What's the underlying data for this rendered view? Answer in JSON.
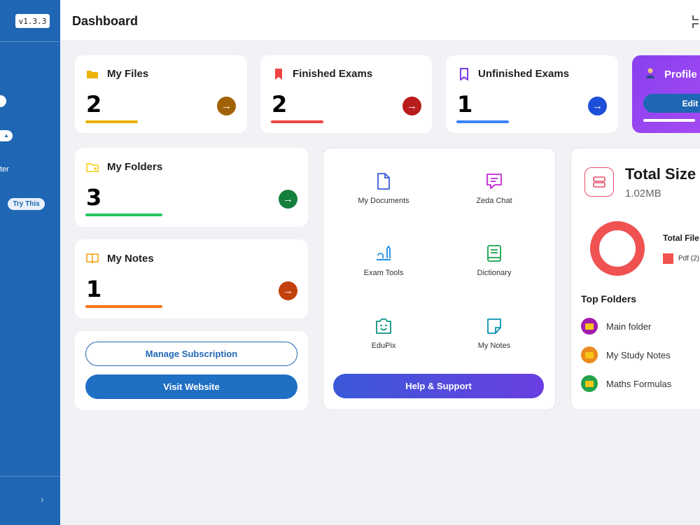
{
  "app": {
    "version": "v1.3.3",
    "page_title": "Dashboard"
  },
  "sidebar": {
    "partial_text": "ter",
    "try_badge": "Try This",
    "collapse_glyph": "›"
  },
  "stats": [
    {
      "title": "My Files",
      "value": "2",
      "icon": "folder-icon",
      "color": "#eab308",
      "arrow_color": "#a16207"
    },
    {
      "title": "Finished Exams",
      "value": "2",
      "icon": "bookmark-icon",
      "color": "#ef4444",
      "arrow_color": "#b91c1c"
    },
    {
      "title": "Unfinished Exams",
      "value": "1",
      "icon": "bookmark-outline-icon",
      "color": "#3b82f6",
      "arrow_color": "#1d4ed8"
    },
    {
      "title": "My Folders",
      "value": "3",
      "icon": "folder-plus-icon",
      "color": "#22c55e",
      "arrow_color": "#15803d"
    },
    {
      "title": "My Notes",
      "value": "1",
      "icon": "book-open-icon",
      "color": "#f97316",
      "arrow_color": "#c2410c"
    }
  ],
  "profile": {
    "title": "Profile",
    "edit_label": "Edit"
  },
  "actions": {
    "manage_subscription": "Manage Subscription",
    "visit_website": "Visit Website"
  },
  "tools": [
    {
      "label": "My Documents",
      "icon": "document-icon",
      "color": "#3b5bdb"
    },
    {
      "label": "Zeda Chat",
      "icon": "chat-icon",
      "color": "#c026d3"
    },
    {
      "label": "Exam Tools",
      "icon": "exam-tools-icon",
      "color": "#1d8fe1"
    },
    {
      "label": "Dictionary",
      "icon": "dictionary-icon",
      "color": "#16a34a"
    },
    {
      "label": "EduPix",
      "icon": "edupix-icon",
      "color": "#0d9488"
    },
    {
      "label": "My Notes",
      "icon": "note-icon",
      "color": "#0891b2"
    }
  ],
  "help_support": "Help & Support",
  "storage": {
    "title": "Total Size",
    "value": "1.02MB",
    "files_label": "Total File",
    "legend": [
      {
        "label": "Pdf (2)",
        "color": "#f05252"
      }
    ],
    "top_folders_title": "Top Folders",
    "folders": [
      {
        "name": "Main folder",
        "color": "#a21caf"
      },
      {
        "name": "My Study Notes",
        "color": "#ea8a1e"
      },
      {
        "name": "Maths Formulas",
        "color": "#22a34a"
      }
    ]
  }
}
